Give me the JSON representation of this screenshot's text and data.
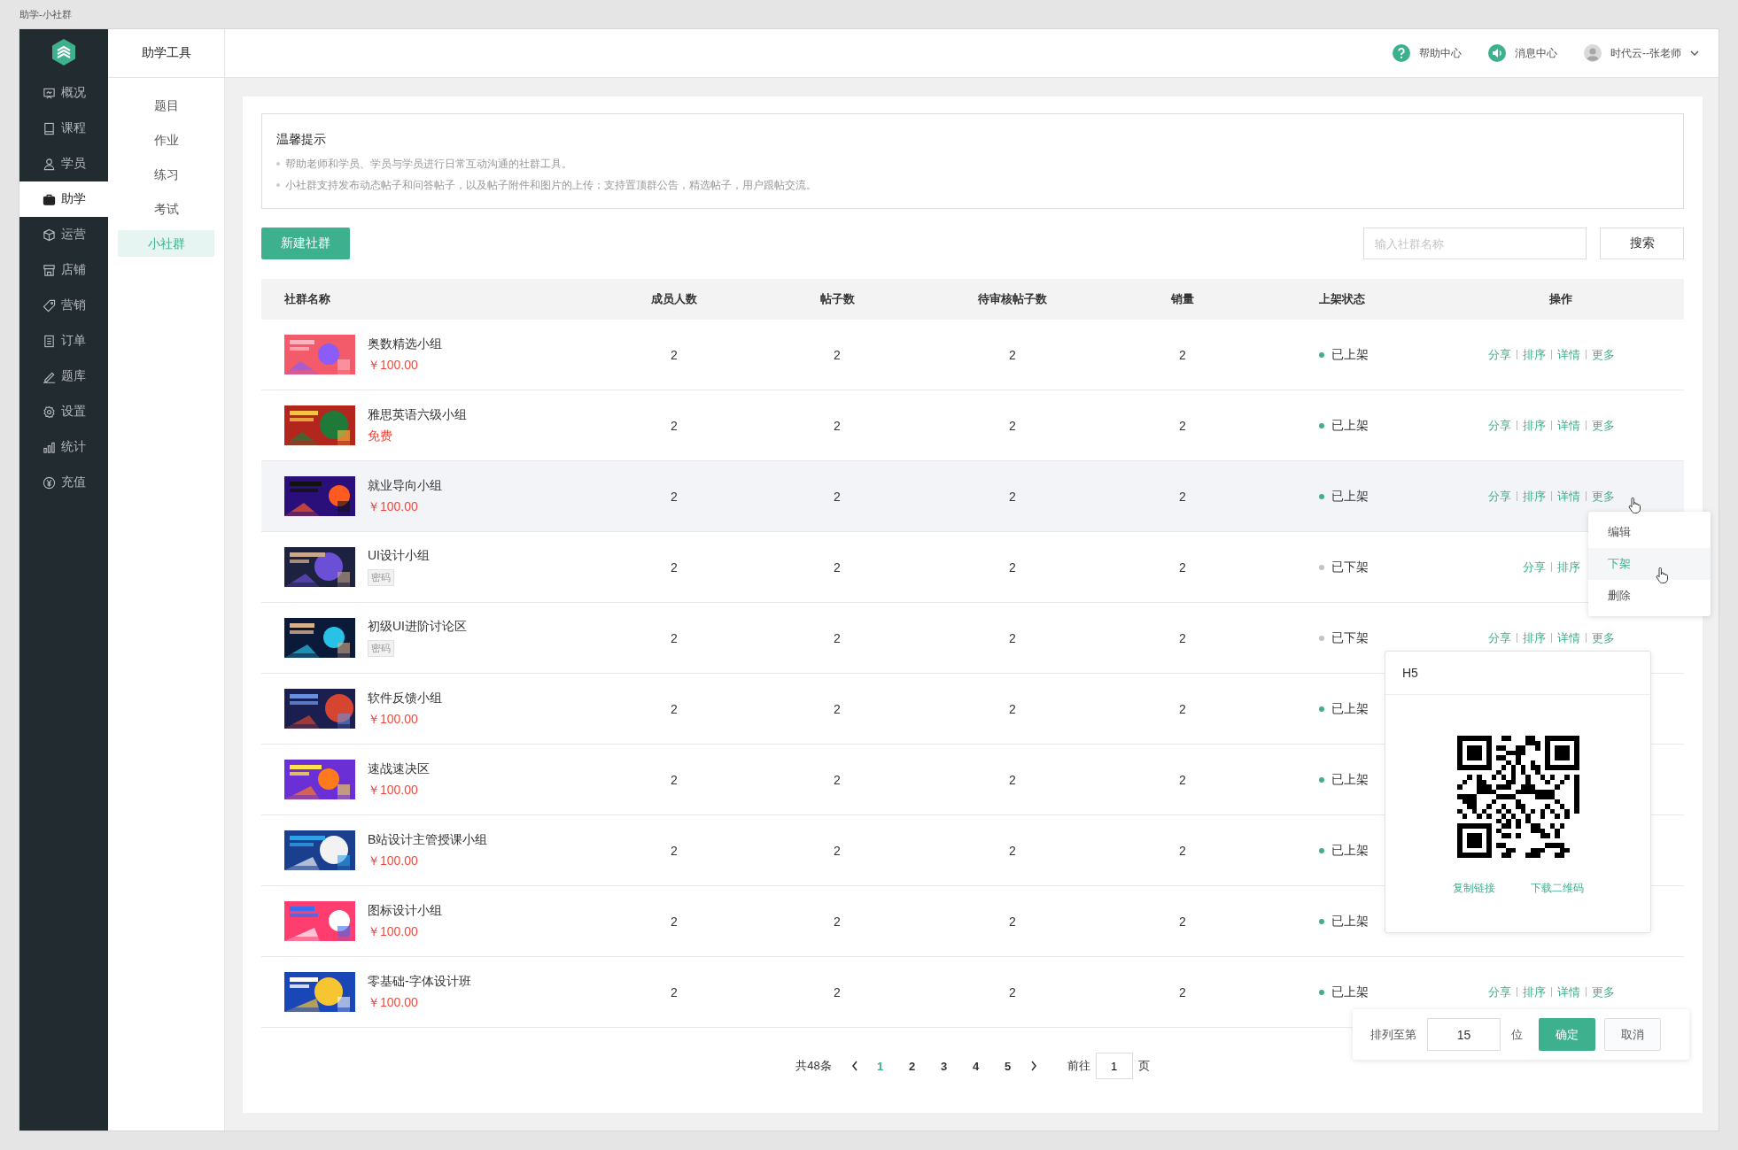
{
  "window": {
    "title": "助学-小社群"
  },
  "nav": [
    {
      "label": "概况",
      "selected": false
    },
    {
      "label": "课程",
      "selected": false
    },
    {
      "label": "学员",
      "selected": false
    },
    {
      "label": "助学",
      "selected": true
    },
    {
      "label": "运营",
      "selected": false
    },
    {
      "label": "店铺",
      "selected": false
    },
    {
      "label": "营销",
      "selected": false
    },
    {
      "label": "订单",
      "selected": false
    },
    {
      "label": "题库",
      "selected": false
    },
    {
      "label": "设置",
      "selected": false
    },
    {
      "label": "统计",
      "selected": false
    },
    {
      "label": "充值",
      "selected": false
    }
  ],
  "subnav": {
    "title": "助学工具",
    "items": [
      {
        "label": "题目",
        "selected": false
      },
      {
        "label": "作业",
        "selected": false
      },
      {
        "label": "练习",
        "selected": false
      },
      {
        "label": "考试",
        "selected": false
      },
      {
        "label": "小社群",
        "selected": true
      }
    ]
  },
  "header": {
    "help": "帮助中心",
    "messages": "消息中心",
    "user": "时代云--张老师"
  },
  "notice": {
    "title": "温馨提示",
    "lines": [
      "帮助老师和学员、学员与学员进行日常互动沟通的社群工具。",
      "小社群支持发布动态帖子和问答帖子，以及帖子附件和图片的上传；支持置顶群公告，精选帖子，用户跟帖交流。"
    ]
  },
  "toolbar": {
    "create": "新建社群",
    "search": {
      "placeholder": "输入社群名称"
    },
    "search_button": "搜索"
  },
  "table": {
    "columns": [
      "社群名称",
      "成员人数",
      "帖子数",
      "待审核帖子数",
      "销量",
      "上架状态",
      "操作"
    ],
    "rows": [
      {
        "name": "奥数精选小组",
        "tag": {
          "kind": "price",
          "text": "￥100.00"
        },
        "members": "2",
        "posts": "2",
        "pending": "2",
        "sales": "2",
        "status": {
          "text": "已上架",
          "on": true
        },
        "hovered": false,
        "actions": [
          "分享",
          "排序",
          "详情",
          "更多"
        ]
      },
      {
        "name": "雅思英语六级小组",
        "tag": {
          "kind": "free",
          "text": "免费"
        },
        "members": "2",
        "posts": "2",
        "pending": "2",
        "sales": "2",
        "status": {
          "text": "已上架",
          "on": true
        },
        "hovered": false,
        "actions": [
          "分享",
          "排序",
          "详情",
          "更多"
        ]
      },
      {
        "name": "就业导向小组",
        "tag": {
          "kind": "price",
          "text": "￥100.00"
        },
        "members": "2",
        "posts": "2",
        "pending": "2",
        "sales": "2",
        "status": {
          "text": "已上架",
          "on": true
        },
        "hovered": true,
        "actions": [
          "分享",
          "排序",
          "详情",
          "更多"
        ]
      },
      {
        "name": "UI设计小组",
        "tag": {
          "kind": "password",
          "text": "密码"
        },
        "members": "2",
        "posts": "2",
        "pending": "2",
        "sales": "2",
        "status": {
          "text": "已下架",
          "on": false
        },
        "hovered": false,
        "actions": [
          "分享",
          "排序"
        ]
      },
      {
        "name": "初级UI进阶讨论区",
        "tag": {
          "kind": "password",
          "text": "密码"
        },
        "members": "2",
        "posts": "2",
        "pending": "2",
        "sales": "2",
        "status": {
          "text": "已下架",
          "on": false
        },
        "hovered": false,
        "actions": [
          "分享",
          "排序",
          "详情",
          "更多"
        ]
      },
      {
        "name": "软件反馈小组",
        "tag": {
          "kind": "price",
          "text": "￥100.00"
        },
        "members": "2",
        "posts": "2",
        "pending": "2",
        "sales": "2",
        "status": {
          "text": "已上架",
          "on": true
        },
        "hovered": false,
        "actions": []
      },
      {
        "name": "速战速决区",
        "tag": {
          "kind": "price",
          "text": "￥100.00"
        },
        "members": "2",
        "posts": "2",
        "pending": "2",
        "sales": "2",
        "status": {
          "text": "已上架",
          "on": true
        },
        "hovered": false,
        "actions": []
      },
      {
        "name": "B站设计主管授课小组",
        "tag": {
          "kind": "price",
          "text": "￥100.00"
        },
        "members": "2",
        "posts": "2",
        "pending": "2",
        "sales": "2",
        "status": {
          "text": "已上架",
          "on": true
        },
        "hovered": false,
        "actions": []
      },
      {
        "name": "图标设计小组",
        "tag": {
          "kind": "price",
          "text": "￥100.00"
        },
        "members": "2",
        "posts": "2",
        "pending": "2",
        "sales": "2",
        "status": {
          "text": "已上架",
          "on": true
        },
        "hovered": false,
        "actions": []
      },
      {
        "name": "零基础-字体设计班",
        "tag": {
          "kind": "price",
          "text": "￥100.00"
        },
        "members": "2",
        "posts": "2",
        "pending": "2",
        "sales": "2",
        "status": {
          "text": "已上架",
          "on": true
        },
        "hovered": false,
        "actions": [
          "分享",
          "排序",
          "详情",
          "更多"
        ]
      }
    ]
  },
  "more_menu": {
    "items": [
      {
        "label": "编辑",
        "selected": false
      },
      {
        "label": "下架",
        "selected": true
      },
      {
        "label": "删除",
        "selected": false
      }
    ]
  },
  "share_popover": {
    "title": "H5",
    "links": [
      "复制链接",
      "下载二维码"
    ]
  },
  "sort_popover": {
    "label": "排列至第",
    "value": "15",
    "unit": "位",
    "confirm": "确定",
    "cancel": "取消"
  },
  "pagination": {
    "total": "共48条",
    "pages": [
      {
        "label": "1",
        "selected": true
      },
      {
        "label": "2",
        "selected": false
      },
      {
        "label": "3",
        "selected": false
      },
      {
        "label": "4",
        "selected": false
      },
      {
        "label": "5",
        "selected": false
      }
    ],
    "goto": "前往",
    "page": "1",
    "unit": "页"
  }
}
